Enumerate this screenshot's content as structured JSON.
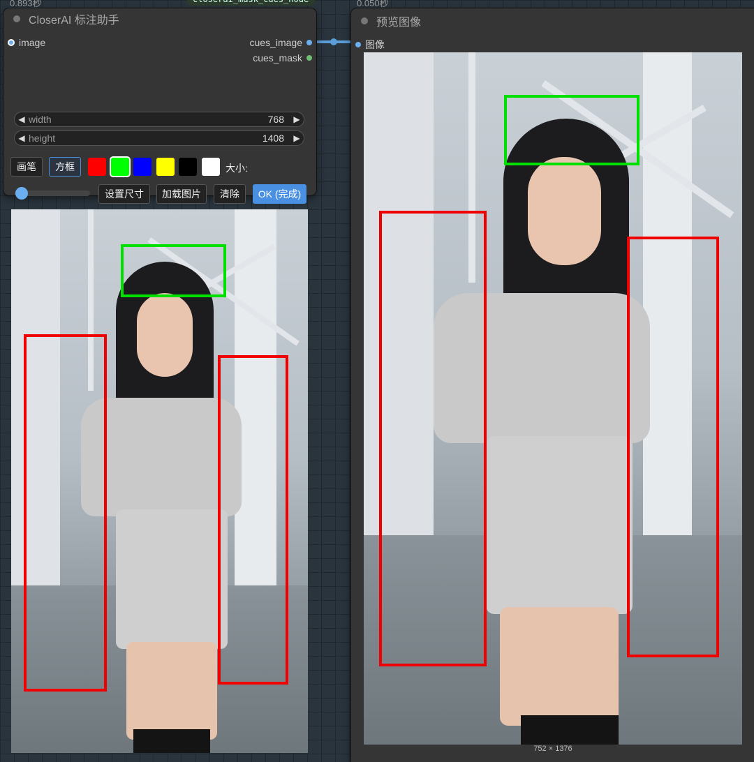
{
  "closer_node": {
    "timing": "0.893秒",
    "title": "CloserAI 标注助手",
    "inputs": [
      {
        "label": "image"
      }
    ],
    "outputs": [
      {
        "label": "cues_image"
      },
      {
        "label": "cues_mask"
      }
    ],
    "widgets": {
      "width": {
        "label": "width",
        "value": "768"
      },
      "height": {
        "label": "height",
        "value": "1408"
      }
    },
    "tools": {
      "brush_label": "画笔",
      "box_label": "方框",
      "size_label": "大小:"
    },
    "colors": [
      "#ff0000",
      "#00ff00",
      "#0000ff",
      "#ffff00",
      "#000000",
      "#ffffff"
    ],
    "selected_color": "#00ff00",
    "buttons": {
      "set_size": "设置尺寸",
      "load_image": "加载图片",
      "clear": "清除",
      "ok": "OK (完成)"
    },
    "brush_size_level": 0.1
  },
  "preview_node": {
    "timing": "0.050秒",
    "title": "预览图像",
    "input_label": "图像",
    "image_size_label": "752 × 1376"
  },
  "center_node_label": "closerai_mask_cues_node",
  "colors": {
    "node_bg": "#353535",
    "canvas_bg": "#2a343d",
    "accent": "#4a90e2",
    "annotation_green": "#00e000",
    "annotation_red": "#f00000"
  }
}
